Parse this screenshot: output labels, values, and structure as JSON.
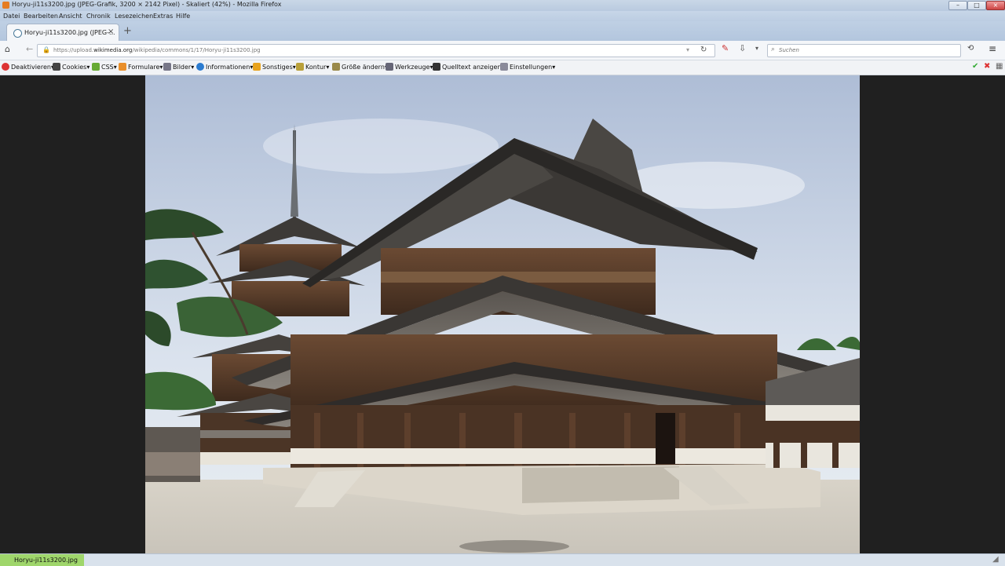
{
  "window": {
    "title": "Horyu-ji11s3200.jpg (JPEG-Grafik, 3200 × 2142 Pixel) - Skaliert (42%) - Mozilla Firefox"
  },
  "menu": [
    "Datei",
    "Bearbeiten",
    "Ansicht",
    "Chronik",
    "Lesezeichen",
    "Extras",
    "Hilfe"
  ],
  "tab": {
    "label": "Horyu-ji11s3200.jpg (JPEG-...",
    "close": "×",
    "new_tab": "+"
  },
  "nav": {
    "url_prefix": "https://upload.",
    "url_domain": "wikimedia.org",
    "url_path": "/wikipedia/commons/1/17/Horyu-ji11s3200.jpg",
    "search_placeholder": "Suchen"
  },
  "devtoolbar": {
    "items": [
      "Deaktivieren",
      "Cookies",
      "CSS",
      "Formulare",
      "Bilder",
      "Informationen",
      "Sonstiges",
      "Kontur",
      "Größe ändern",
      "Werkzeuge",
      "Quelltext anzeigen",
      "Einstellungen"
    ]
  },
  "status": {
    "text": "Horyu-ji11s3200.jpg"
  },
  "colors": {
    "titlebar": "#c9d7e7",
    "viewport_bg": "#202020",
    "status_highlight": "#9fd66b"
  }
}
